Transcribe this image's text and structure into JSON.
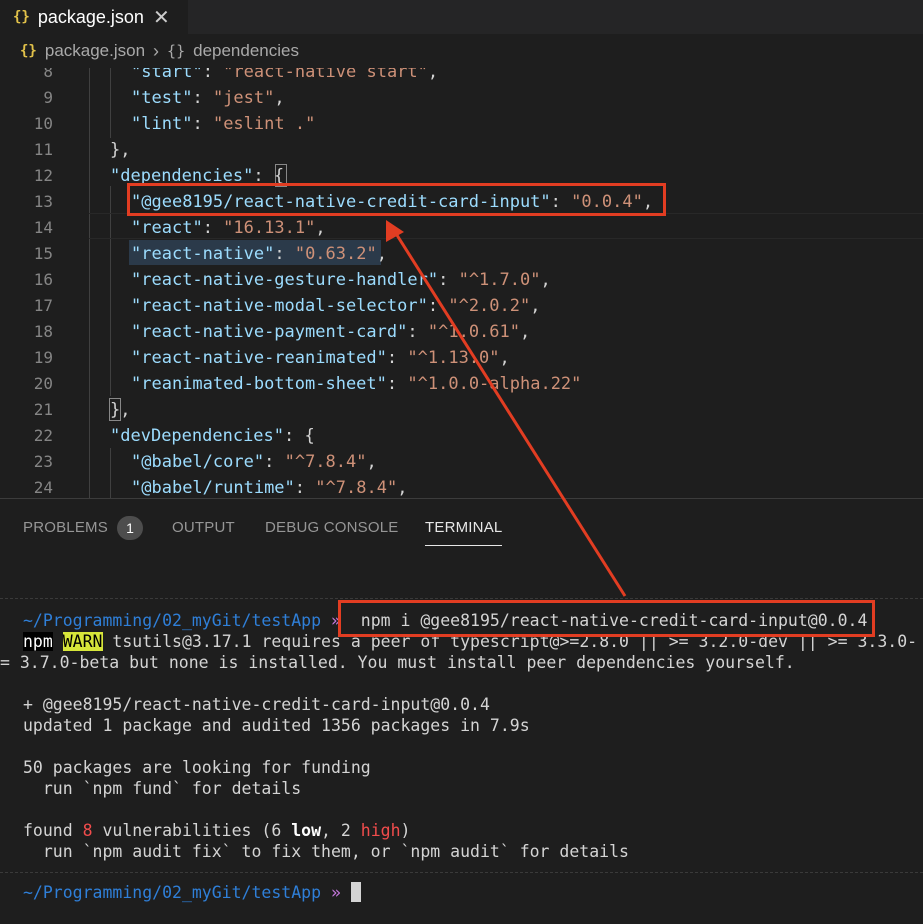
{
  "tab": {
    "icon": "json-icon",
    "label": "package.json"
  },
  "breadcrumb": {
    "file": "package.json",
    "section": "dependencies"
  },
  "editor": {
    "lines": [
      {
        "n": "8",
        "key": "start",
        "value": "react-native start",
        "trail": ","
      },
      {
        "n": "9",
        "key": "test",
        "value": "jest",
        "trail": ","
      },
      {
        "n": "10",
        "key": "lint",
        "value": "eslint .",
        "trail": ""
      },
      {
        "n": "11",
        "text": "},"
      },
      {
        "n": "12",
        "key": "dependencies",
        "open": "{"
      },
      {
        "n": "13",
        "key": "@gee8195/react-native-credit-card-input",
        "value": "0.0.4",
        "trail": ","
      },
      {
        "n": "14",
        "key": "react",
        "value": "16.13.1",
        "trail": ","
      },
      {
        "n": "15",
        "key": "react-native",
        "value": "0.63.2",
        "trail": ","
      },
      {
        "n": "16",
        "key": "react-native-gesture-handler",
        "value": "^1.7.0",
        "trail": ","
      },
      {
        "n": "17",
        "key": "react-native-modal-selector",
        "value": "^2.0.2",
        "trail": ","
      },
      {
        "n": "18",
        "key": "react-native-payment-card",
        "value": "^1.0.61",
        "trail": ","
      },
      {
        "n": "19",
        "key": "react-native-reanimated",
        "value": "^1.13.0",
        "trail": ","
      },
      {
        "n": "20",
        "key": "reanimated-bottom-sheet",
        "value": "^1.0.0-alpha.22",
        "trail": ""
      },
      {
        "n": "21",
        "text": "},"
      },
      {
        "n": "22",
        "key": "devDependencies",
        "open": "{"
      },
      {
        "n": "23",
        "key": "@babel/core",
        "value": "^7.8.4",
        "trail": ","
      },
      {
        "n": "24",
        "key": "@babel/runtime",
        "value": "^7.8.4",
        "trail": ","
      }
    ]
  },
  "panel": {
    "tabs": {
      "problems": "PROBLEMS",
      "output": "OUTPUT",
      "debug": "DEBUG CONSOLE",
      "terminal": "TERMINAL"
    },
    "problems_count": "1"
  },
  "terminal": {
    "path": "~/Programming/02_myGit/testApp",
    "prompt": "»",
    "command": "npm i @gee8195/react-native-credit-card-input@0.0.4",
    "npm": "npm",
    "warn": "WARN",
    "warn_text": " tsutils@3.17.1 requires a peer of typescript@>=2.8.0 || >= 3.2.0-dev || >= 3.3.0-",
    "warn_text2": "= 3.7.0-beta but none is installed. You must install peer dependencies yourself.",
    "added": "+ @gee8195/react-native-credit-card-input@0.0.4",
    "updated": "updated 1 package and audited 1356 packages in 7.9s",
    "funding": "50 packages are looking for funding",
    "fund_hint": "  run `npm fund` for details",
    "found_pre": "found ",
    "vuln_count": "8",
    "found_mid": " vulnerabilities (6 ",
    "low": "low",
    "comma": ", 2 ",
    "high": "high",
    "close": ")",
    "audit_hint": "  run `npm audit fix` to fix them, or `npm audit` for details"
  }
}
